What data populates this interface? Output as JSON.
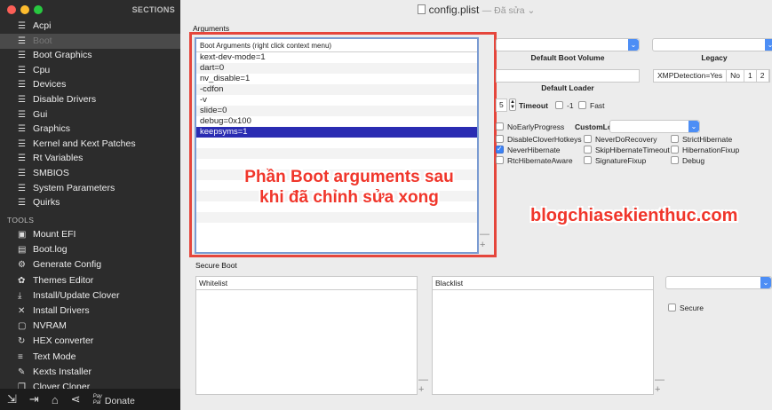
{
  "sidebar": {
    "sections_title": "SECTIONS",
    "items": [
      {
        "label": "Acpi",
        "icon": "list-icon"
      },
      {
        "label": "Boot",
        "icon": "list-icon",
        "selected": true
      },
      {
        "label": "Boot Graphics",
        "icon": "list-icon"
      },
      {
        "label": "Cpu",
        "icon": "list-icon"
      },
      {
        "label": "Devices",
        "icon": "list-icon"
      },
      {
        "label": "Disable Drivers",
        "icon": "list-icon"
      },
      {
        "label": "Gui",
        "icon": "list-icon"
      },
      {
        "label": "Graphics",
        "icon": "list-icon"
      },
      {
        "label": "Kernel and Kext Patches",
        "icon": "list-icon"
      },
      {
        "label": "Rt Variables",
        "icon": "list-icon"
      },
      {
        "label": "SMBIOS",
        "icon": "list-icon"
      },
      {
        "label": "System Parameters",
        "icon": "list-icon"
      },
      {
        "label": "Quirks",
        "icon": "list-icon"
      }
    ],
    "tools_title": "TOOLS",
    "tools": [
      {
        "label": "Mount EFI",
        "icon": "disk-icon"
      },
      {
        "label": "Boot.log",
        "icon": "log-icon"
      },
      {
        "label": "Generate Config",
        "icon": "gears-icon"
      },
      {
        "label": "Themes Editor",
        "icon": "palette-icon"
      },
      {
        "label": "Install/Update Clover",
        "icon": "download-icon"
      },
      {
        "label": "Install Drivers",
        "icon": "tools-icon"
      },
      {
        "label": "NVRAM",
        "icon": "chip-icon"
      },
      {
        "label": "HEX converter",
        "icon": "refresh-icon"
      },
      {
        "label": "Text Mode",
        "icon": "text-icon"
      },
      {
        "label": "Kexts Installer",
        "icon": "wrench-icon"
      },
      {
        "label": "Clover Cloner",
        "icon": "clone-icon"
      }
    ],
    "bottom": {
      "donate_label": "Donate",
      "pay_label": "Pay\nPal"
    }
  },
  "window": {
    "title": "config.plist",
    "edited": "— Đã sửa ⌄"
  },
  "arguments": {
    "section_label": "Arguments",
    "list_header": "Boot Arguments (right click context menu)",
    "items": [
      "kext-dev-mode=1",
      "dart=0",
      "nv_disable=1",
      "-cdfon",
      "-v",
      "slide=0",
      "debug=0x100",
      "keepsyms=1"
    ],
    "selected_index": 7
  },
  "annotation": {
    "line1": "Phần Boot arguments sau",
    "line2": "khi đã chỉnh sửa xong"
  },
  "watermark": "blogchiasekienthuc.com",
  "boot": {
    "default_boot_volume_label": "Default Boot Volume",
    "legacy_label": "Legacy",
    "default_loader_label": "Default Loader",
    "xmp": [
      "XMPDetection=Yes",
      "No",
      "1",
      "2"
    ],
    "timeout_value": "5",
    "timeout_label": "Timeout",
    "minus1_label": "-1",
    "fast_label": "Fast",
    "noearly_label": "NoEarlyProgress",
    "customlogo_label": "CustomLogo",
    "checkboxes": [
      {
        "label": "DisableCloverHotkeys",
        "checked": false
      },
      {
        "label": "NeverDoRecovery",
        "checked": false
      },
      {
        "label": "StrictHibernate",
        "checked": false
      },
      {
        "label": "NeverHibernate",
        "checked": true
      },
      {
        "label": "SkipHibernateTimeout",
        "checked": false
      },
      {
        "label": "HibernationFixup",
        "checked": false
      },
      {
        "label": "RtcHibernateAware",
        "checked": false
      },
      {
        "label": "SignatureFixup",
        "checked": false
      },
      {
        "label": "Debug",
        "checked": false
      }
    ]
  },
  "secure_boot": {
    "section_label": "Secure Boot",
    "whitelist_label": "Whitelist",
    "blacklist_label": "Blacklist",
    "secure_label": "Secure"
  },
  "colors": {
    "selection": "#2a2cb2",
    "annotation": "#f0362b",
    "sidebar": "#2c2c2c",
    "accent": "#4d8ef5"
  }
}
